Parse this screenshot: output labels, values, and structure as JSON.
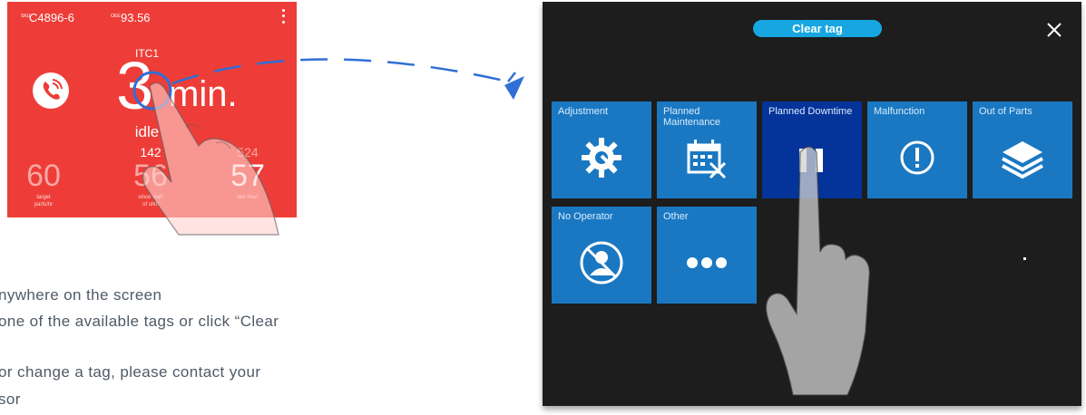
{
  "card": {
    "sku_label": "SKU",
    "sku": "C4896-6",
    "oee_label": "OEE",
    "oee": "93.56",
    "station": "ITC1",
    "duration_value": "3",
    "duration_unit": "min.",
    "state": "idle",
    "stats": [
      {
        "top": "",
        "value": "60",
        "label_line1": "target",
        "label_line2": "parts/hr"
      },
      {
        "top": "142",
        "value": "56",
        "label_line1": "since start",
        "label_line2": "of shift"
      },
      {
        "top": "524",
        "value": "57",
        "label_line1": "last hour",
        "label_line2": ""
      }
    ],
    "colors": {
      "card_bg": "#ee3d38",
      "touch_ring": "#2f6fd6"
    }
  },
  "instructions": [
    "nywhere on the screen",
    "one of the available tags or click “Clear",
    "or change a tag, please contact your",
    "sor"
  ],
  "dialog": {
    "clear_tag_label": "Clear tag",
    "close_icon": "close-icon",
    "tiles": [
      {
        "label": "Adjustment",
        "icon": "gear-wrench-icon",
        "selected": false
      },
      {
        "label": "Planned Maintenance",
        "icon": "calendar-tools-icon",
        "selected": false
      },
      {
        "label": "Planned Downtime",
        "icon": "pause-icon",
        "selected": true
      },
      {
        "label": "Malfunction",
        "icon": "exclamation-circle-icon",
        "selected": false
      },
      {
        "label": "Out of Parts",
        "icon": "layers-icon",
        "selected": false
      },
      {
        "label": "No Operator",
        "icon": "no-user-icon",
        "selected": false
      },
      {
        "label": "Other",
        "icon": "ellipsis-icon",
        "selected": false
      }
    ],
    "colors": {
      "dialog_bg": "#1d1d1d",
      "tile": "#1a78c2",
      "tile_selected": "#04339a",
      "pill": "#17a6e0"
    }
  }
}
